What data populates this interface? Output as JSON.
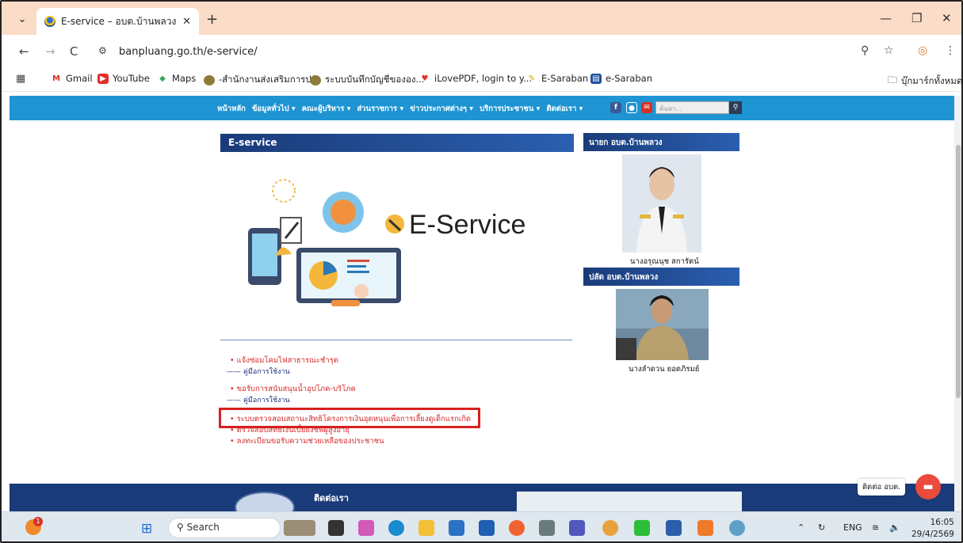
{
  "browser": {
    "tab_title": "E-service – อบต.บ้านพลวง อ.ปราสา",
    "url": "banpluang.go.th/e-service/",
    "bookmarks": [
      "Gmail",
      "YouTube",
      "Maps",
      "-สำนักงานส่งเสริมการป...",
      "ระบบบันทึกบัญชีขององ...",
      "iLovePDF, login to y...",
      "E-Saraban",
      "e-Saraban"
    ],
    "all_bookmarks": "บุ๊กมาร์กทั้งหมด"
  },
  "site": {
    "menu": [
      "หน้าหลัก",
      "ข้อมูลทั่วไป ▾",
      "คณะผู้บริหาร ▾",
      "ส่วนราชการ ▾",
      "ข่าวประกาศต่างๆ ▾",
      "บริการประชาชน ▾",
      "ติดต่อเรา ▾"
    ],
    "search_placeholder": "ค้นหา...",
    "main_heading": "E-service",
    "banner_text": "E-Service",
    "services": [
      {
        "label": "แจ้งซ่อมโคมไฟสาธารณะชำรุด",
        "manual": "คู่มือการใช้งาน"
      },
      {
        "label": "ขอรับการสนับสนุนน้ำอุปโภค-บริโภค",
        "manual": "คู่มือการใช้งาน"
      },
      {
        "label": "ระบบตรวจสอบสถานะสิทธิโครงการเงินอุดหนุนเพื่อการเลี้ยงดูเด็กแรกเกิด"
      },
      {
        "label": "ตรวจสอบสิทธิเงินเบี้ยยังชีพผู้สูงอายุ"
      },
      {
        "label": "ลงทะเบียนขอรับความช่วยเหลือของประชาชน"
      }
    ],
    "mayor_heading": "นายก อบต.บ้านพลวง",
    "mayor_name": "นางอรุณนุช สการัตน์",
    "clerk_heading": "ปลัด อบต.บ้านพลวง",
    "clerk_name": "นางลำดวน ยอดภิรมย์",
    "footer_heading": "ติดต่อเรา",
    "chat_label": "ติดต่อ อบต."
  },
  "taskbar": {
    "search": "Search",
    "lang": "ENG",
    "time": "16:05",
    "date": "29/4/2569",
    "notification_badge": "1"
  }
}
